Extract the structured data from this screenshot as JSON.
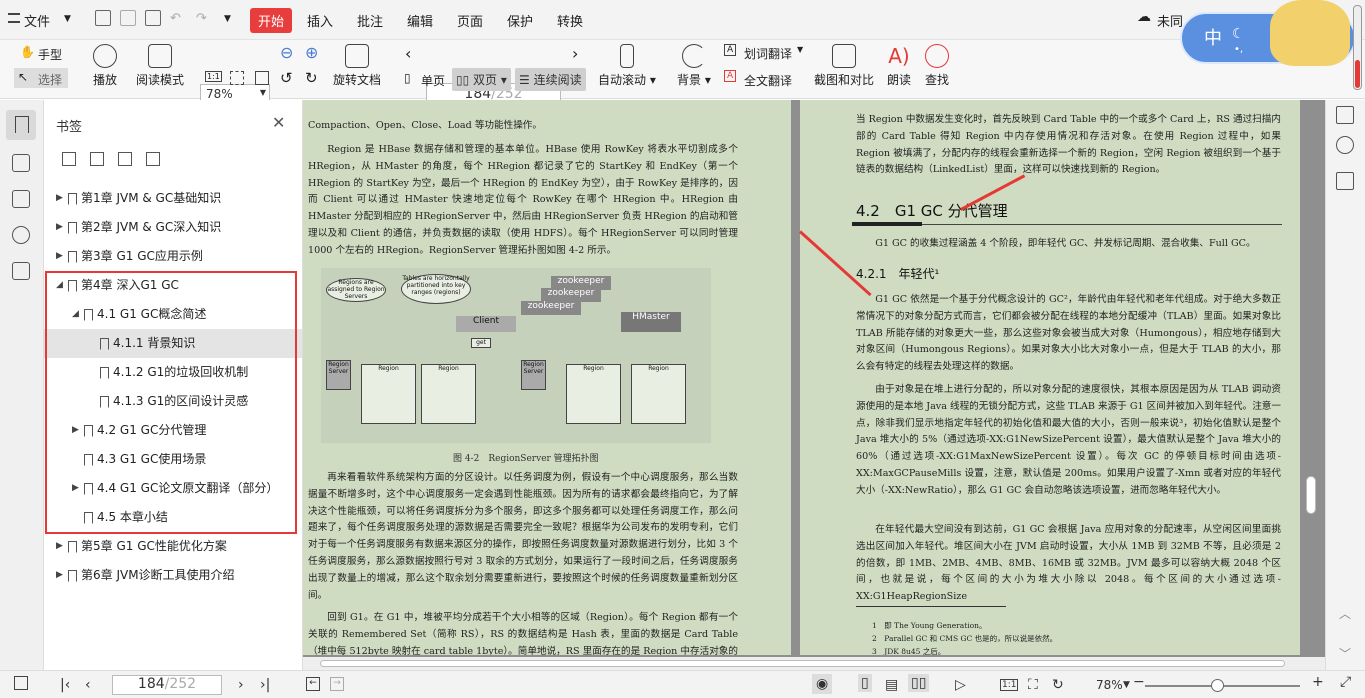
{
  "menu": {
    "file": "文件",
    "items": [
      "开始",
      "插入",
      "批注",
      "编辑",
      "页面",
      "保护",
      "转换"
    ],
    "active": "开始",
    "cloud": "未同"
  },
  "toolbar": {
    "hand": "手型",
    "select": "选择",
    "play": "播放",
    "read_mode": "阅读模式",
    "zoom": "78%",
    "rotate": "旋转文档",
    "page_current": "184",
    "page_total": "/252",
    "single": "单页",
    "double": "双页",
    "continuous": "连续阅读",
    "auto_scroll": "自动滚动",
    "background": "背景",
    "word_translate": "划词翻译",
    "full_translate": "全文翻译",
    "screenshot": "截图和对比",
    "read_aloud": "朗读",
    "find": "查找"
  },
  "widget": {
    "lang": "中"
  },
  "panel": {
    "title": "书签",
    "items": [
      {
        "label": "第1章 JVM & GC基础知识",
        "arrow": "▶"
      },
      {
        "label": "第2章 JVM & GC深入知识",
        "arrow": "▶"
      },
      {
        "label": "第3章 G1 GC应用示例",
        "arrow": "▶"
      },
      {
        "label": "第4章 深入G1 GC",
        "arrow": "◢"
      },
      {
        "label": "4.1 G1 GC概念简述",
        "arrow": "◢"
      },
      {
        "label": "4.1.1 背景知识",
        "arrow": ""
      },
      {
        "label": "4.1.2 G1的垃圾回收机制",
        "arrow": ""
      },
      {
        "label": "4.1.3 G1的区间设计灵感",
        "arrow": ""
      },
      {
        "label": "4.2 G1 GC分代管理",
        "arrow": "▶"
      },
      {
        "label": "4.3 G1 GC使用场景",
        "arrow": ""
      },
      {
        "label": "4.4 G1 GC论文原文翻译（部分）",
        "arrow": "▶"
      },
      {
        "label": "4.5 本章小结",
        "arrow": ""
      },
      {
        "label": "第5章 G1 GC性能优化方案",
        "arrow": "▶"
      },
      {
        "label": "第6章 JVM诊断工具使用介绍",
        "arrow": "▶"
      }
    ]
  },
  "left_page": {
    "p0": "Compaction、Open、Close、Load 等功能性操作。",
    "p1": "Region 是 HBase 数据存储和管理的基本单位。HBase 使用 RowKey 将表水平切割成多个HRegion，从 HMaster 的角度，每个 HRegion 都记录了它的 StartKey 和 EndKey（第一个 HRegion 的 StartKey 为空，最后一个 HRegion 的 EndKey 为空），由于 RowKey 是排序的，因而 Client 可以通过 HMaster 快速地定位每个 RowKey 在哪个 HRegion 中。HRegion 由 HMaster 分配到相应的 HRegionServer 中，然后由 HRegionServer 负责 HRegion 的启动和管理以及和 Client 的通信，并负责数据的读取（使用 HDFS）。每个 HRegionServer 可以同时管理 1000 个左右的 HRegion。RegionServer 管理拓扑图如图 4-2 所示。",
    "figure": {
      "note1": "Regions are assigned to Region Servers",
      "note2": "Tables are horizontally partitioned into key ranges (regions)",
      "zk": "zookeeper",
      "client": "Client",
      "hmaster": "HMaster",
      "get": "get",
      "region": "Region",
      "rs": "Region Server",
      "size": "1GB",
      "startkey": "startKey",
      "endkey": "endKey",
      "key": "Key",
      "col": "col",
      "val": "val",
      "xxx": "xxx"
    },
    "caption": "图 4-2　RegionServer 管理拓扑图",
    "p2": "再来看看软件系统架构方面的分区设计。以任务调度为例，假设有一个中心调度服务，那么当数据量不断增多时，这个中心调度服务一定会遇到性能瓶颈。因为所有的请求都会最终指向它，为了解决这个性能瓶颈，可以将任务调度拆分为多个服务，即这多个服务都可以处理任务调度工作，那么问题来了，每个任务调度服务处理的源数据是否需要完全一致呢？根据华为公司发布的发明专利，它们对于每一个任务调度服务有数据来源区分的操作，即按照任务调度数量对源数据进行划分，比如 3 个任务调度服务，那么源数据按照行号对 3 取余的方式划分，如果运行了一段时间之后，任务调度服务出现了数量上的增减，那么这个取余划分需要重新进行，要按照这个时候的任务调度数量重新划分区间。",
    "p3": "回到 G1。在 G1 中，堆被平均分成若干个大小相等的区域（Region）。每个 Region 都有一个关联的 Remembered Set（简称 RS），RS 的数据结构是 Hash 表，里面的数据是 Card Table（堆中每 512byte 映射在 card table 1byte）。简单地说，RS 里面存在的是 Region 中存活对象的指针。"
  },
  "right_page": {
    "p0": "当 Region 中数据发生变化时，首先反映到 Card Table 中的一个或多个 Card 上，RS 通过扫描内部的 Card Table 得知 Region 中内存使用情况和存活对象。在使用 Region 过程中，如果 Region 被填满了，分配内存的线程会重新选择一个新的 Region，空闲 Region 被组织到一个基于链表的数据结构（LinkedList）里面，这样可以快速找到新的 Region。",
    "h42": "4.2　G1 GC 分代管理",
    "p1": "G1 GC 的收集过程涵盖 4 个阶段，即年轻代 GC、并发标记周期、混合收集、Full GC。",
    "h421": "4.2.1　年轻代¹",
    "p2": "G1 GC 依然是一个基于分代概念设计的 GC²，年龄代由年轻代和老年代组成。对于绝大多数正常情况下的对象分配方式而言，它们都会被分配在线程的本地分配缓冲（TLAB）里面。如果对象比 TLAB 所能存储的对象更大一些，那么这些对象会被当成大对象（Humongous），相应地存储到大对象区间（Humongous Regions）。如果对象大小比大对象小一点，但是大于 TLAB 的大小，那么会有特定的线程去处理这样的数据。",
    "p3": "由于对象是在堆上进行分配的，所以对象分配的速度很快，其根本原因是因为从 TLAB 调动资源使用的是本地 Java 线程的无锁分配方式，这些 TLAB 来源于 G1 区间并被加入到年轻代。注意一点，除非我们显示地指定年轻代的初始化值和最大值的大小，否则一般来说³，初始化值默认是整个 Java 堆大小的 5%（通过选项-XX:G1NewSizePercent 设置），最大值默认是整个 Java 堆大小的 60%（通过选项-XX:G1MaxNewSizePercent 设置）。每次 GC 的停顿目标时间由选项-XX:MaxGCPauseMills 设置，注意，默认值是 200ms。如果用户设置了-Xmn 或者对应的年轻代大小（-XX:NewRatio），那么 G1 GC 会自动忽略该选项设置，进而忽略年轻代大小。",
    "p4": "在年轻代最大空间没有到达前，G1 GC 会根据 Java 应用对象的分配速率，从空闲区间里面挑选出区间加入年轻代。堆区间大小在 JVM 启动时设置，大小从 1MB 到 32MB 不等，且必须是 2 的倍数，即 1MB、2MB、4MB、8MB、16MB 或 32MB。JVM 最多可以容纳大概 2048 个区间，也就是说，每个区间的大小为堆大小除以 2048。每个区间的大小通过选项-XX:G1HeapRegionSize",
    "fn1": "1　即 The Young Generation。",
    "fn2": "2　Parallel GC 和 CMS GC 也是的，所以说是依然。",
    "fn3": "3　JDK 8u45 之后。"
  },
  "status": {
    "page_current": "184",
    "page_total": "/252",
    "zoom": "78%",
    "zoom_level": 0.43
  }
}
